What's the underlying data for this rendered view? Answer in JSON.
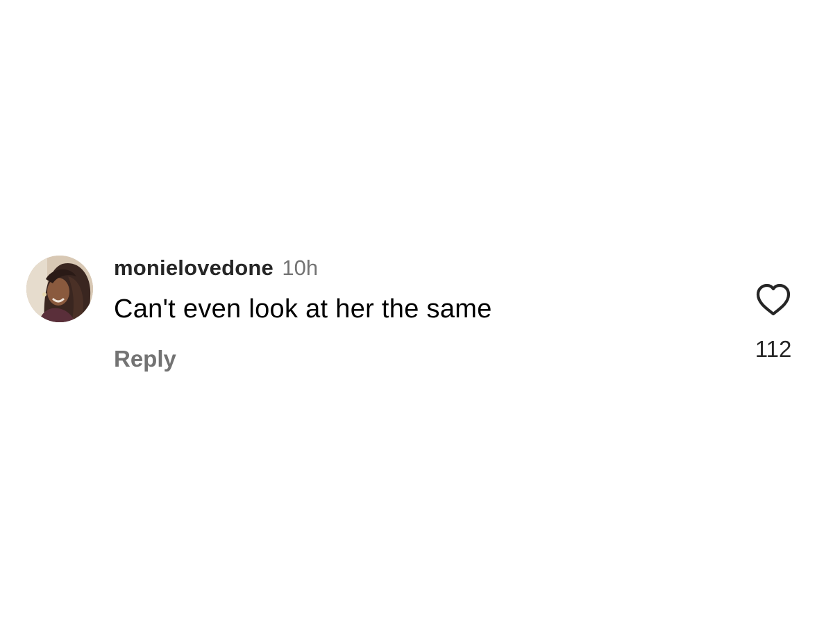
{
  "comment": {
    "username": "monielovedone",
    "timestamp": "10h",
    "text": "Can't even look at her the same",
    "reply_label": "Reply",
    "like_count": "112",
    "like_icon": "heart-outline-icon",
    "avatar": "profile-photo"
  },
  "colors": {
    "username": "#262626",
    "secondary_text": "#737373",
    "body_text": "#000000",
    "icon_stroke": "#262626",
    "background": "#ffffff"
  }
}
